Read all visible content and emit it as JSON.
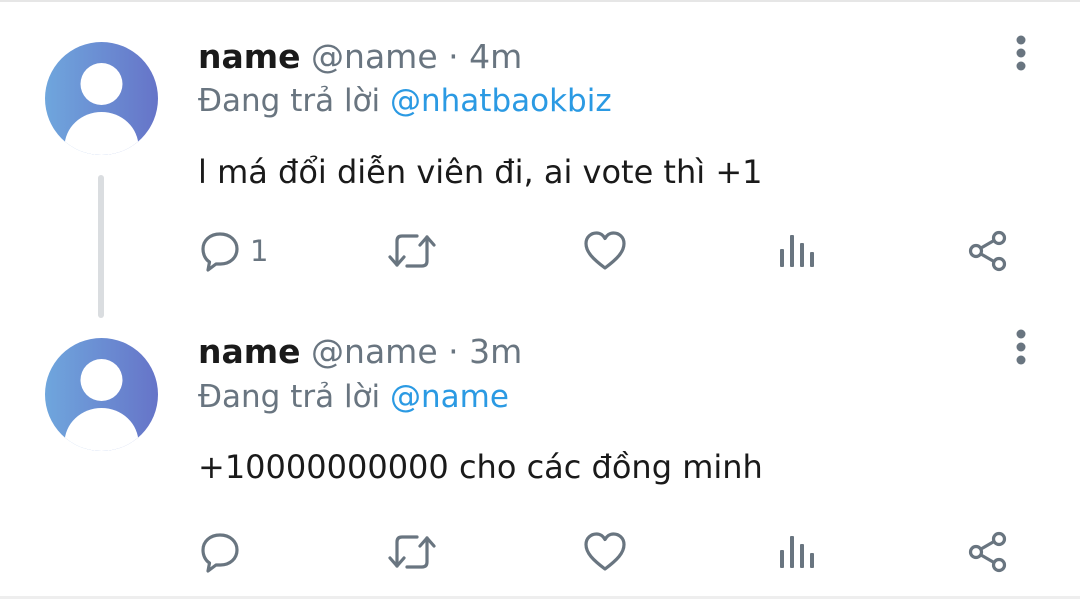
{
  "tweets": [
    {
      "display_name": "name",
      "handle": "@name",
      "separator": "·",
      "time": "4m",
      "reply_prefix": "Đang trả lời",
      "reply_to": "@nhatbaokbiz",
      "text": "l má đổi diễn viên đi, ai vote thì +1",
      "reply_count": "1",
      "icons": {
        "more": "more-vertical-icon",
        "reply": "comment-icon",
        "retweet": "retweet-icon",
        "like": "heart-icon",
        "views": "analytics-icon",
        "share": "share-icon"
      }
    },
    {
      "display_name": "name",
      "handle": "@name",
      "separator": "·",
      "time": "3m",
      "reply_prefix": "Đang trả lời",
      "reply_to": "@name",
      "text": "+10000000000 cho các đồng minh",
      "reply_count": "",
      "icons": {
        "more": "more-vertical-icon",
        "reply": "comment-icon",
        "retweet": "retweet-icon",
        "like": "heart-icon",
        "views": "analytics-icon",
        "share": "share-icon"
      }
    }
  ],
  "colors": {
    "text_primary": "#1a1a1a",
    "text_secondary": "#697580",
    "mention": "#2b9ae3",
    "icon": "#697580",
    "avatar_gradient_start": "#6fa6dd",
    "avatar_gradient_end": "#6674c8"
  }
}
